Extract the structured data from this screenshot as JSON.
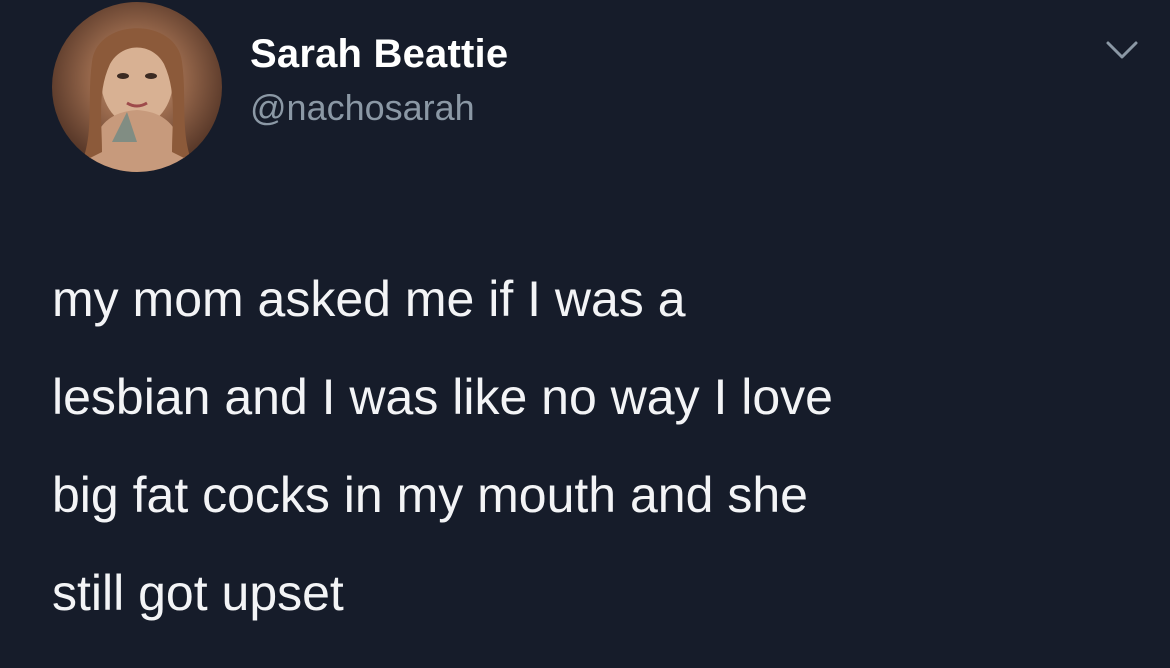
{
  "author": {
    "display_name": "Sarah Beattie",
    "handle": "@nachosarah",
    "avatar_icon": "profile-photo"
  },
  "menu": {
    "icon": "chevron-down-icon"
  },
  "tweet": {
    "lines": [
      "my mom asked me if I was a",
      "lesbian and I was like no way I love",
      "big fat cocks in my mouth and she",
      "still got upset"
    ]
  },
  "colors": {
    "background": "#161c2a",
    "primary_text": "#ffffff",
    "secondary_text": "#8b98a5"
  }
}
